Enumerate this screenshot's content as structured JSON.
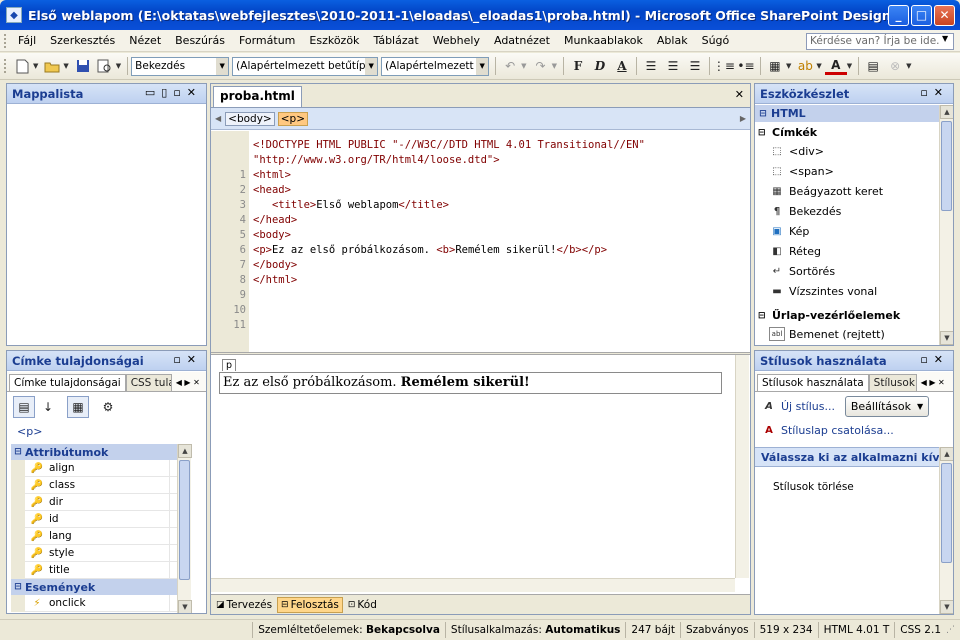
{
  "window": {
    "title": "Első weblapom (E:\\oktatas\\webfejlesztes\\2010-2011-1\\eloadas\\_eloadas1\\proba.html) - Microsoft Office SharePoint Designer",
    "minimize": "_",
    "maximize": "□",
    "close": "✕"
  },
  "menubar": {
    "items": [
      "Fájl",
      "Szerkesztés",
      "Nézet",
      "Beszúrás",
      "Formátum",
      "Eszközök",
      "Táblázat",
      "Webhely",
      "Adatnézet",
      "Munkaablakok",
      "Ablak",
      "Súgó"
    ],
    "help_placeholder": "Kérdése van? Írja be ide."
  },
  "toolbar": {
    "style_combo": "Bekezdés",
    "font_combo": "(Alapértelmezett betűtípus)",
    "size_combo": "(Alapértelmezett m",
    "bold": "F",
    "italic": "D",
    "underline": "A"
  },
  "folder_panel": {
    "title": "Mappalista"
  },
  "tag_props": {
    "title": "Címke tulajdonságai",
    "tabs": [
      "Címke tulajdonságai",
      "CSS tula"
    ],
    "current_tag": "<p>",
    "categories": [
      {
        "label": "Attribútumok",
        "items": [
          "align",
          "class",
          "dir",
          "id",
          "lang",
          "style",
          "title"
        ]
      },
      {
        "label": "Események",
        "items": [
          "onclick"
        ]
      }
    ]
  },
  "editor": {
    "tab": "proba.html",
    "breadcrumbs": [
      "<body>",
      "<p>"
    ],
    "line_numbers": [
      "1",
      "2",
      "3",
      "4",
      "5",
      "6",
      "7",
      "8",
      "9",
      "10",
      "11"
    ],
    "lines": [
      [
        "doc",
        "<!DOCTYPE HTML PUBLIC \"-//W3C//DTD HTML 4.01 Transitional//EN\""
      ],
      [
        "doc",
        "\"http://www.w3.org/TR/html4/loose.dtd\">"
      ],
      [
        "tag",
        "<html>"
      ],
      [
        "tag",
        "<head>"
      ],
      [
        "mix",
        "   <title>Első weblapom</title>"
      ],
      [
        "tag",
        "</head>"
      ],
      [
        "tag",
        "<body>"
      ],
      [
        "mix",
        "<p>Ez az első próbálkozásom. <b>Remélem sikerül!</b></p>"
      ],
      [
        "tag",
        "</body>"
      ],
      [
        "tag",
        "</html>"
      ],
      [
        "tag",
        ""
      ]
    ],
    "design_tag": "p",
    "design_text": "Ez az első próbálkozásom. ",
    "design_bold": "Remélem sikerül!",
    "view_buttons": [
      "Tervezés",
      "Felosztás",
      "Kód"
    ],
    "active_view": "Felosztás"
  },
  "toolbox": {
    "title": "Eszközkészlet",
    "section": "HTML",
    "group1": "Címkék",
    "items": [
      {
        "icon": "div-icon",
        "label": "<div>"
      },
      {
        "icon": "span-icon",
        "label": "<span>"
      },
      {
        "icon": "iframe-icon",
        "label": "Beágyazott keret"
      },
      {
        "icon": "paragraph-icon",
        "label": "Bekezdés"
      },
      {
        "icon": "image-icon",
        "label": "Kép"
      },
      {
        "icon": "layer-icon",
        "label": "Réteg"
      },
      {
        "icon": "line-break-icon",
        "label": "Sortörés"
      },
      {
        "icon": "horizontal-line-icon",
        "label": "Vízszintes vonal"
      }
    ],
    "group2": "Űrlap-vezérlőelemek",
    "form_items": [
      {
        "icon": "hidden-input-icon",
        "label": "Bemenet (rejtett)"
      }
    ]
  },
  "styles_panel": {
    "title": "Stílusok használata",
    "tabs": [
      "Stílusok használata",
      "Stílusok ke"
    ],
    "new_style": "Új stílus...",
    "options_button": "Beállítások",
    "attach_css": "Stíluslap csatolása...",
    "apply_heading": "Válassza ki az alkalmazni kív...",
    "clear_styles": "Stílusok törlése"
  },
  "statusbar": {
    "visual_aids_label": "Szemléltetőelemek:",
    "visual_aids_value": "Bekapcsolva",
    "style_app_label": "Stílusalkalmazás:",
    "style_app_value": "Automatikus",
    "size": "247 bájt",
    "mode": "Szabványos",
    "dimensions": "519 x 234",
    "html_version": "HTML 4.01 T",
    "css_version": "CSS 2.1"
  }
}
